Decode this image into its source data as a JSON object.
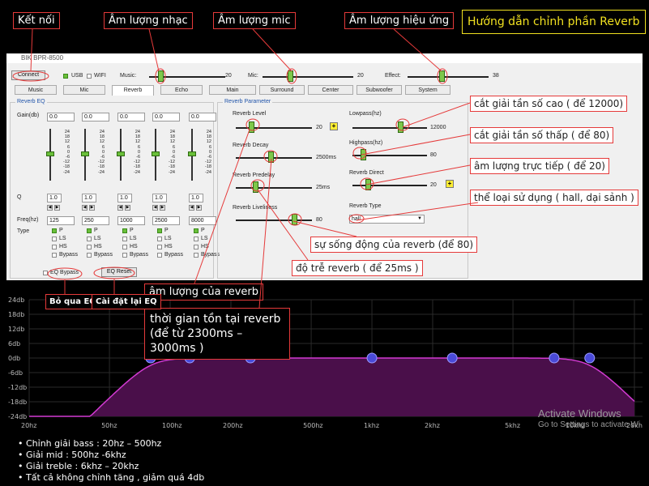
{
  "callouts": {
    "connect": "Kết nối",
    "music_volume": "Âm lượng nhạc",
    "mic_volume": "Âm lượng mic",
    "effect_volume": "Âm lượng hiệu ứng",
    "guide_title": "Hướng dẫn chỉnh phần Reverb",
    "lowpass": "cắt giải tần số cao ( để 12000)",
    "highpass": "cắt giải tần số thấp ( để 80)",
    "direct": "âm lượng trực tiếp ( để 20)",
    "type": "thể loại sử dụng ( hall, dại sảnh )",
    "liveliness": "sự sống động của reverb (để 80)",
    "predelay": "độ trễ reverb ( để 25ms )",
    "level": "âm lượng của reverb",
    "decay": "thời gian tồn tại reverb (để từ 2300ms – 3000ms )",
    "eq_bypass": "Bỏ qua EQ",
    "eq_reset": "Cài đặt lại EQ"
  },
  "window": {
    "title": "BIK BPR-8500",
    "connect_label": "Connect",
    "usb_label": "USB",
    "wifi_label": "WIFI",
    "music_label": "Music:",
    "music_value": "20",
    "mic_label": "Mic:",
    "mic_value": "20",
    "effect_label": "Effect:",
    "effect_value": "38"
  },
  "tabs": [
    "Music",
    "Mic",
    "Reverb",
    "Echo",
    "Main",
    "Surround",
    "Center",
    "Subwoofer",
    "System"
  ],
  "active_tab": "Reverb",
  "eq": {
    "group_label": "Reverb EQ",
    "gain_label": "Gain(db)",
    "q_label": "Q",
    "freq_label": "Freq(hz)",
    "type_label": "Type",
    "gains": [
      "0.0",
      "0.0",
      "0.0",
      "0.0",
      "0.0"
    ],
    "ticks": [
      "24",
      "18",
      "12",
      "6",
      "0",
      "-6",
      "-12",
      "-18",
      "-24"
    ],
    "q": [
      "1.0",
      "1.0",
      "1.0",
      "1.0",
      "1.0"
    ],
    "freqs": [
      "125",
      "250",
      "1000",
      "2500",
      "8000"
    ],
    "type_p": "P",
    "type_ls": "LS",
    "type_hs": "HS",
    "type_bypass": "Bypass",
    "bypass_label": "EQ Bypass",
    "reset_label": "EQ Reset"
  },
  "params": {
    "group_label": "Reverb Parameter",
    "level_label": "Reverb Level",
    "level_value": "20",
    "decay_label": "Reverb Decay",
    "decay_value": "2500ms",
    "predelay_label": "Reverb Predelay",
    "predelay_value": "25ms",
    "liveliness_label": "Reverb Liveliness",
    "liveliness_value": "80",
    "lowpass_label": "Lowpass(hz)",
    "lowpass_value": "12000",
    "highpass_label": "Highpass(hz)",
    "highpass_value": "80",
    "direct_label": "Reverb Direct",
    "direct_value": "20",
    "type_label": "Reverb Type",
    "type_value": "hall",
    "plus": "+"
  },
  "graph": {
    "y_ticks": [
      "24db",
      "18db",
      "12db",
      "6db",
      "0db",
      "-6db",
      "-12db",
      "-18db",
      "-24db"
    ],
    "x_ticks": [
      "20hz",
      "50hz",
      "100hz",
      "200hz",
      "500hz",
      "1khz",
      "2khz",
      "5khz",
      "10khz",
      "20khz"
    ],
    "hp_label": "HP"
  },
  "notes": [
    "• Chỉnh giải bass : 20hz – 500hz",
    "• Giải mid : 500hz -6khz",
    "• Giải treble : 6khz – 20khz",
    "• Tất cả không chỉnh tăng , giảm quá 4db"
  ],
  "watermark": {
    "line1": "Activate Windows",
    "line2": "Go to Settings to activate Wi"
  }
}
